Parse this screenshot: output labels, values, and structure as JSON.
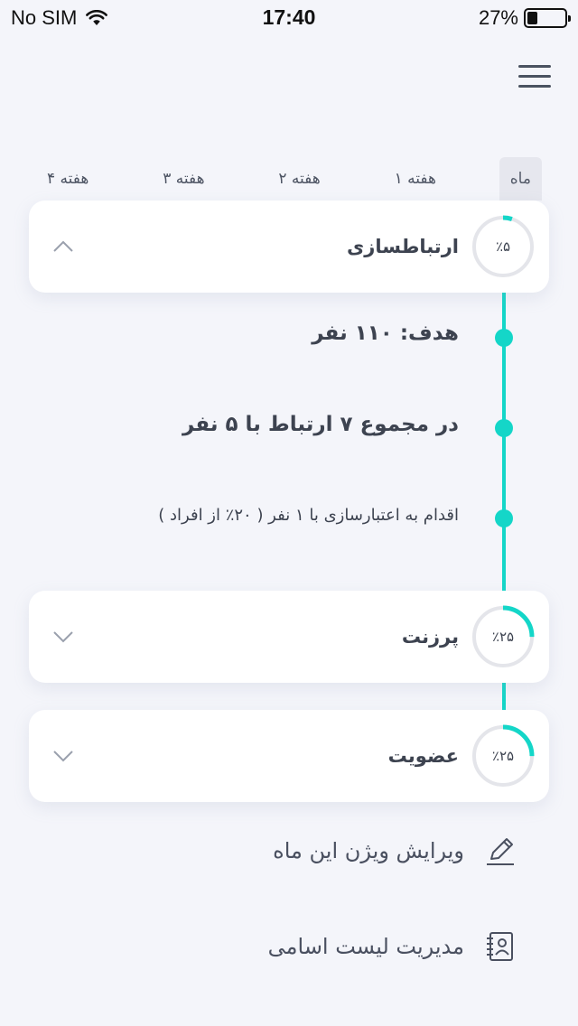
{
  "status_bar": {
    "carrier": "No SIM",
    "time": "17:40",
    "battery_percent": "27%",
    "battery_level": 0.27
  },
  "tabs": [
    {
      "label": "ماه",
      "active": true
    },
    {
      "label": "هفته ۱",
      "active": false
    },
    {
      "label": "هفته ۲",
      "active": false
    },
    {
      "label": "هفته ۳",
      "active": false
    },
    {
      "label": "هفته ۴",
      "active": false
    }
  ],
  "cards": [
    {
      "title": "ارتباطسازی",
      "percent_label": "٪۵",
      "progress": 0.05,
      "expanded": true
    },
    {
      "title": "پرزنت",
      "percent_label": "٪۲۵",
      "progress": 0.25,
      "expanded": false
    },
    {
      "title": "عضویت",
      "percent_label": "٪۲۵",
      "progress": 0.25,
      "expanded": false
    }
  ],
  "timeline": {
    "goal": "هدف: ۱۱۰ نفر",
    "total": "در مجموع ۷ ارتباط با ۵ نفر",
    "action": "اقدام به اعتبارسازی با ۱ نفر ( ۲۰٪ از افراد )"
  },
  "actions": {
    "edit_vision": "ویرایش ویژن این ماه",
    "manage_list": "مدیریت لیست اسامی"
  },
  "colors": {
    "accent": "#14d6c8",
    "background": "#f4f5fa",
    "text": "#3d4350",
    "ring_track": "#e4e5ea"
  },
  "icons": {
    "menu": "hamburger-menu-icon",
    "collapse": "chevron-up-icon",
    "expand": "chevron-down-icon",
    "edit": "pencil-icon",
    "contacts": "contact-list-icon"
  }
}
